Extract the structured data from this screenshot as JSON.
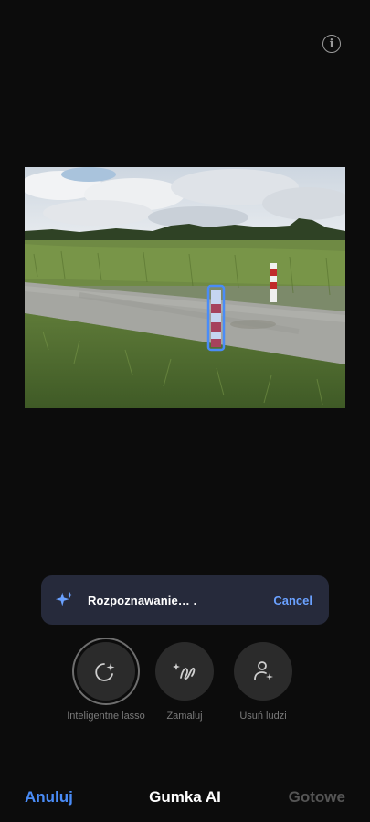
{
  "header": {
    "info_icon": "info-icon",
    "info_glyph": "i"
  },
  "toast": {
    "icon": "sparkle-icon",
    "text": "Rozpoznawanie… .",
    "cancel_label": "Cancel",
    "accent": "#6aa1ff"
  },
  "tools": [
    {
      "label": "Inteligentne lasso",
      "icon": "smart-lasso-icon",
      "selected": true
    },
    {
      "label": "Zamaluj",
      "icon": "brush-sparkle-icon",
      "selected": false
    },
    {
      "label": "Usuń ludzi",
      "icon": "remove-people-icon",
      "selected": false
    }
  ],
  "bottom_bar": {
    "cancel_label": "Anuluj",
    "title": "Gumka AI",
    "done_label": "Gotowe",
    "cancel_color": "#4a8cf7",
    "done_color": "#555555"
  }
}
